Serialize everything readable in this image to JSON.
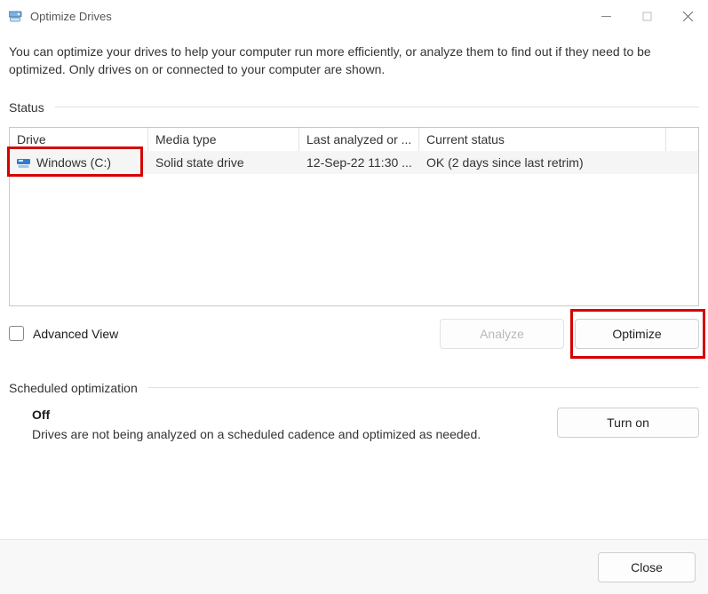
{
  "window": {
    "title": "Optimize Drives"
  },
  "intro": "You can optimize your drives to help your computer run more efficiently, or analyze them to find out if they need to be optimized. Only drives on or connected to your computer are shown.",
  "status": {
    "label": "Status",
    "headers": {
      "drive": "Drive",
      "media": "Media type",
      "last": "Last analyzed or ...",
      "current": "Current status"
    },
    "rows": [
      {
        "drive": "Windows (C:)",
        "media": "Solid state drive",
        "last": "12-Sep-22 11:30 ...",
        "current": "OK (2 days since last retrim)"
      }
    ]
  },
  "advanced_view_label": "Advanced View",
  "buttons": {
    "analyze": "Analyze",
    "optimize": "Optimize",
    "turn_on": "Turn on",
    "close": "Close"
  },
  "scheduled": {
    "label": "Scheduled optimization",
    "state": "Off",
    "desc": "Drives are not being analyzed on a scheduled cadence and optimized as needed."
  }
}
